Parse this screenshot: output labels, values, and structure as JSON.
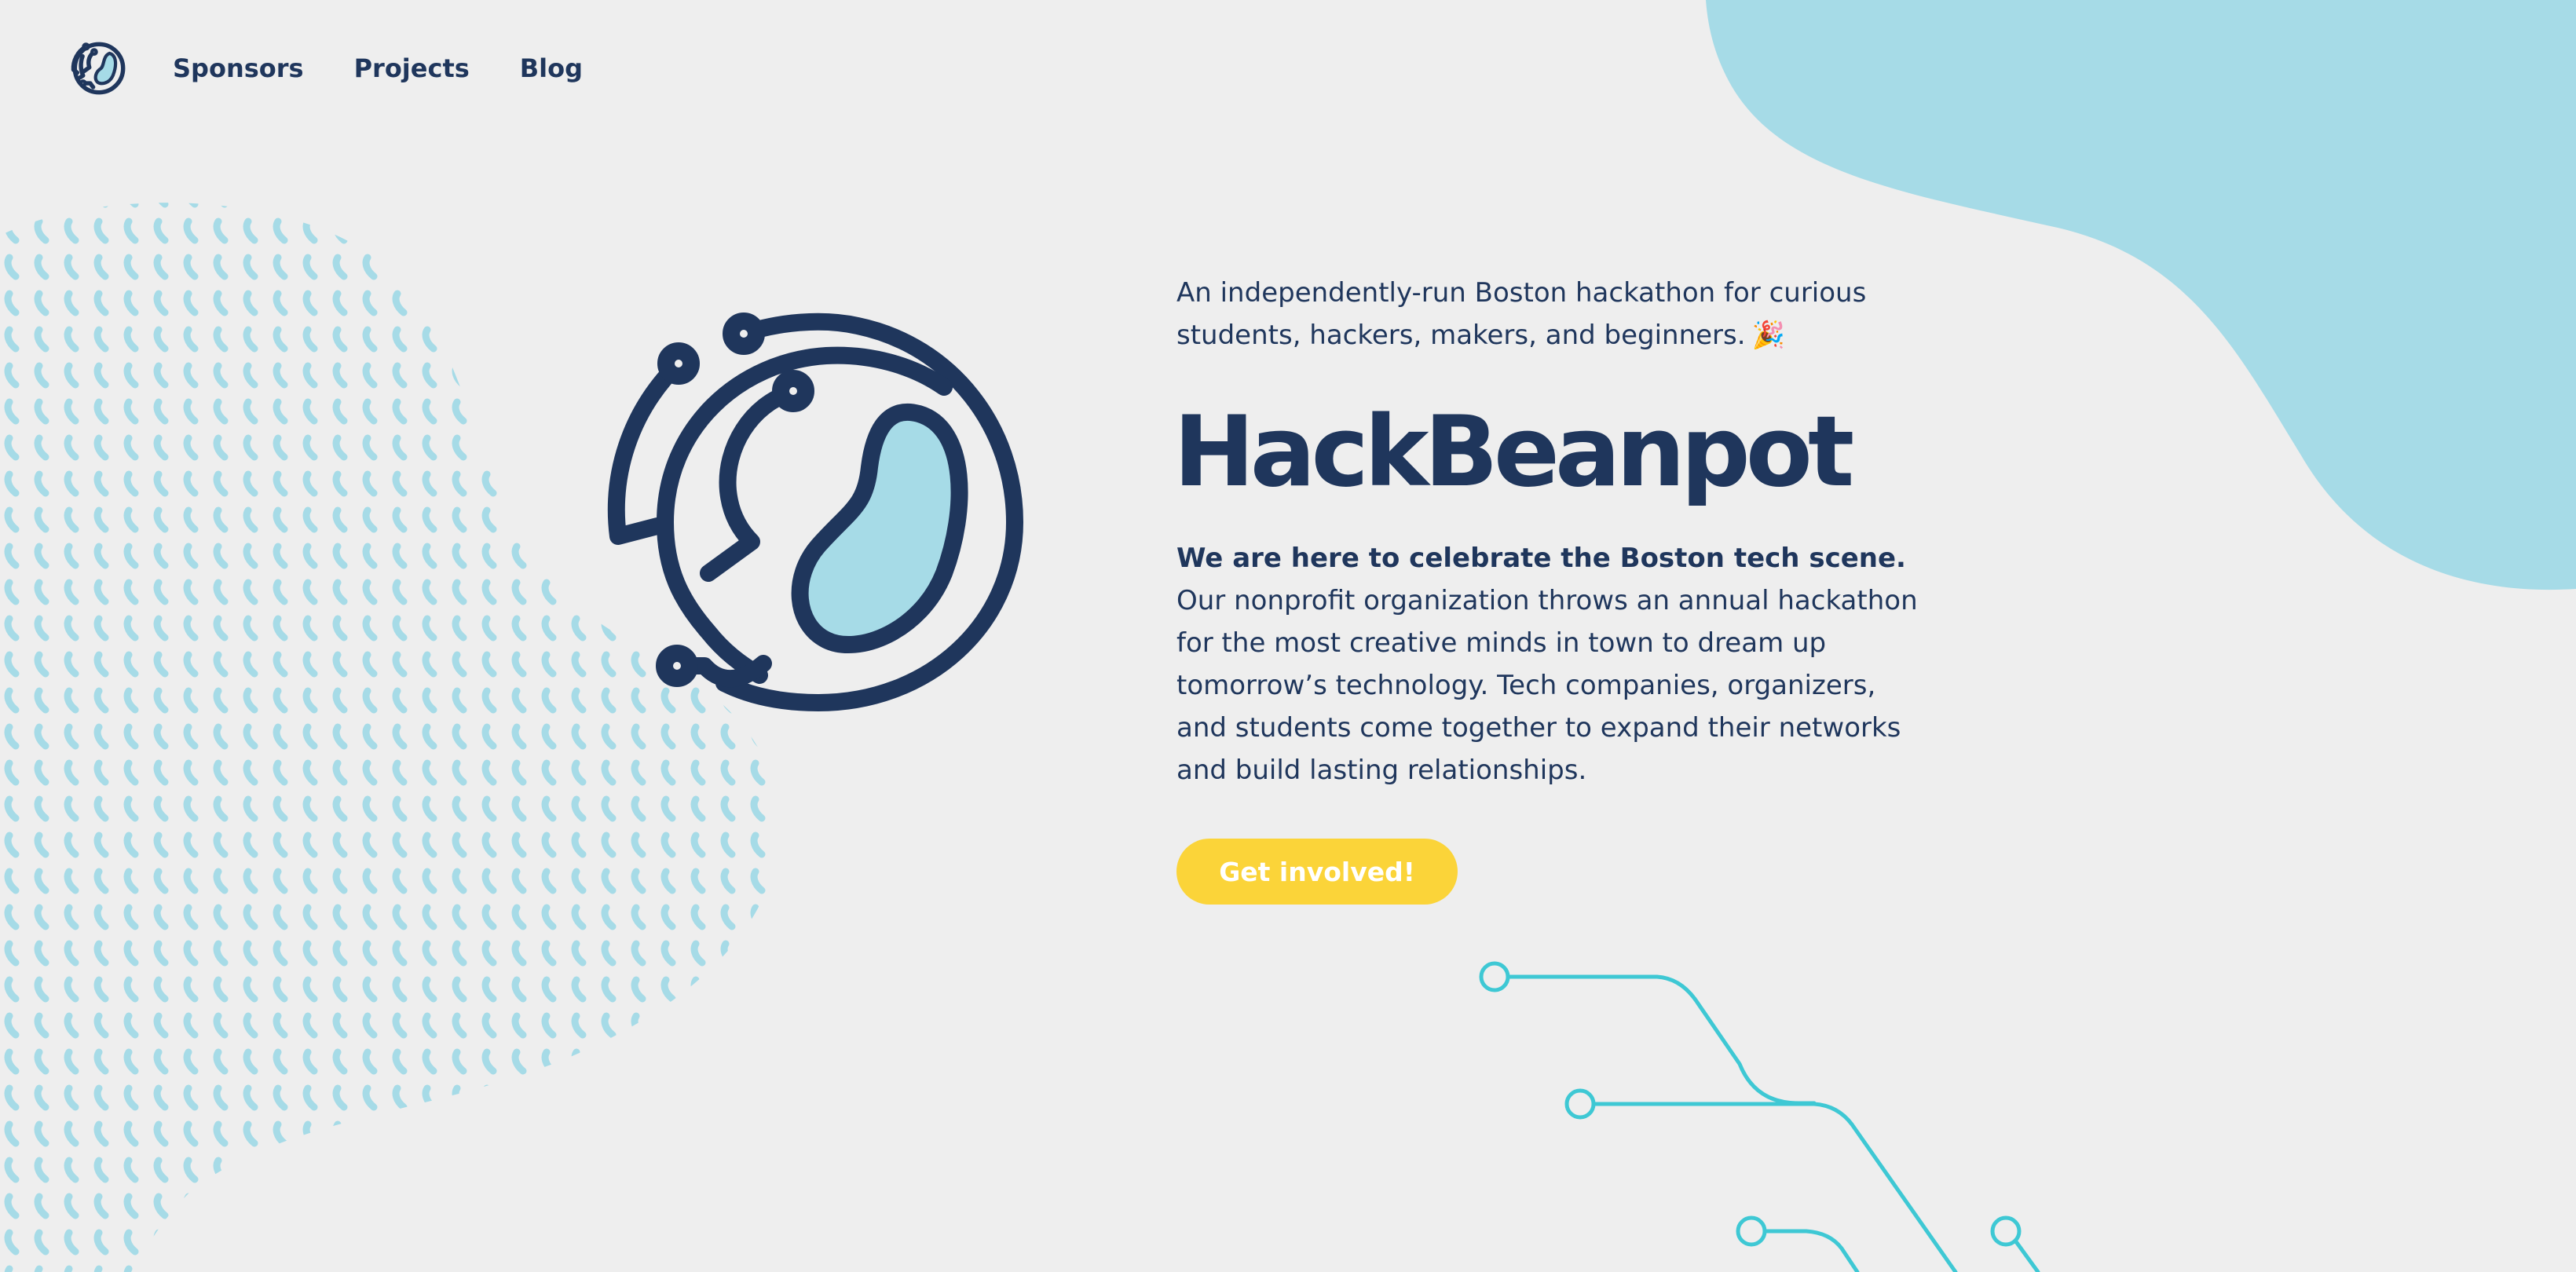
{
  "nav": {
    "logo_icon": "hackbeanpot-logo-icon",
    "links": [
      {
        "label": "Sponsors"
      },
      {
        "label": "Projects"
      },
      {
        "label": "Blog"
      }
    ]
  },
  "hero": {
    "tagline": "An independently-run Boston hackathon for curious students, hackers, makers, and beginners.",
    "tagline_emoji": "🎉",
    "title": "HackBeanpot",
    "lead": "We are here to celebrate the Boston tech scene.",
    "description": "Our nonprofit organization throws an annual hackathon for the most creative minds in town to dream up tomorrow’s technology. Tech companies, organizers, and students come together to expand their networks and build lasting relationships.",
    "cta_label": "Get involved!",
    "logo_icon": "hackbeanpot-logo-icon"
  },
  "colors": {
    "background": "#eeeeee",
    "navy": "#1f365c",
    "light_blue": "#a6dbe7",
    "yellow": "#fbd439",
    "teal": "#3ec8d4"
  }
}
